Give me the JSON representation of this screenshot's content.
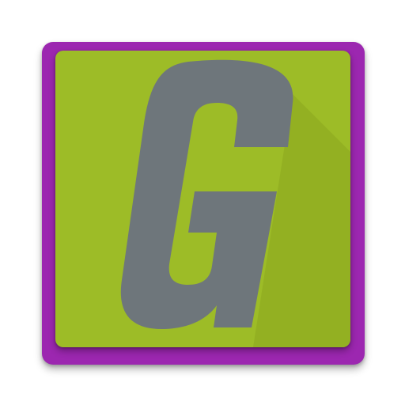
{
  "app_icon": {
    "letter": "G",
    "icon_name": "letter-g-icon",
    "colors": {
      "frame": "#9c27b0",
      "panel": "#9dbc27",
      "letter": "#6e767b",
      "long_shadow": "#93b022"
    }
  }
}
